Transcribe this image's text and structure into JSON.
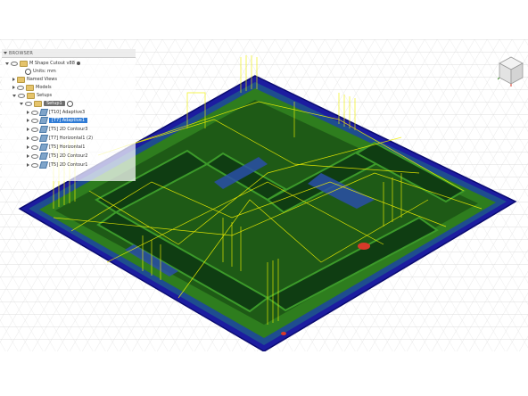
{
  "browser": {
    "title": "BROWSER",
    "document": "M Shape Cutout v88",
    "units": "Units: mm",
    "named_views": "Named Views",
    "models": "Models",
    "setups": "Setups",
    "setup": "Setup1",
    "operations": [
      {
        "label": "[T10] Adaptive3",
        "selected": false
      },
      {
        "label": "[T7] Adaptive1",
        "selected": true
      },
      {
        "label": "[T5] 2D Contour3",
        "selected": false
      },
      {
        "label": "[T7] Horizontal1 (2)",
        "selected": false
      },
      {
        "label": "[T5] Horizontal1",
        "selected": false
      },
      {
        "label": "[T5] 2D Contour2",
        "selected": false
      },
      {
        "label": "[T5] 2D Contour1",
        "selected": false
      }
    ]
  },
  "viewcube": {
    "face": "FRONT"
  },
  "colors": {
    "stock_outline": "#2a2aa8",
    "material": "#1e4d8f",
    "toolpath_green": "#2e7d1e",
    "dark_green": "#0f3d12",
    "rapid_yellow": "#f0f000",
    "selected": "#2f7bd6"
  },
  "icons": [
    "eye-icon",
    "folder-icon",
    "toolpath-op-icon",
    "gear-icon",
    "pin-icon",
    "expand-arrow-icon",
    "viewcube-icon"
  ]
}
